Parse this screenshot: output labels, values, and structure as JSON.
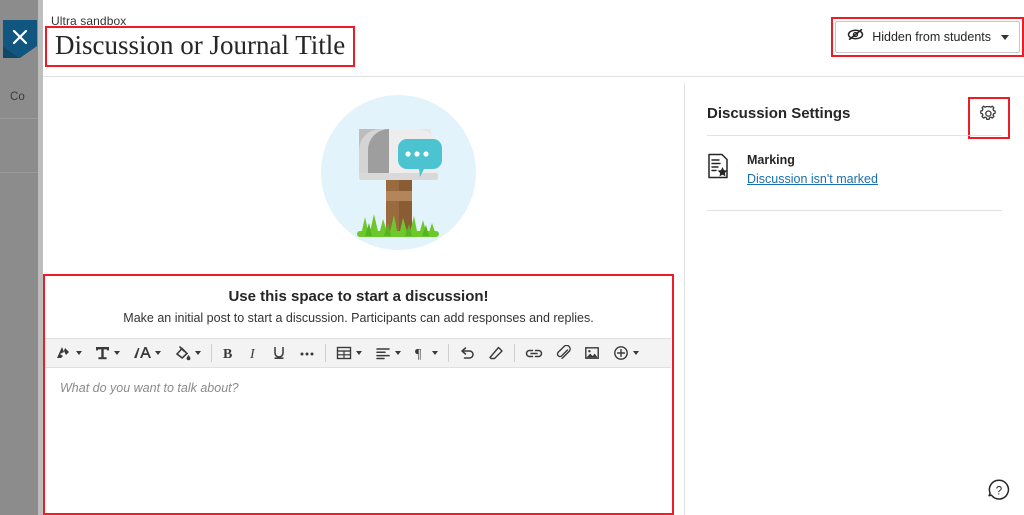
{
  "window": {
    "close_label": "Close",
    "accent_red": "#ee1c25",
    "ribbon_color": "#11567f",
    "link_color": "#1a6fb0"
  },
  "background_page": {
    "partial_label": "Co"
  },
  "header": {
    "breadcrumb": "Ultra sandbox",
    "title": "Discussion or Journal Title",
    "visibility": {
      "icon": "eye-slash-icon",
      "label": "Hidden from students",
      "caret": "chevron-down-icon"
    }
  },
  "main": {
    "illustration": "mailbox-with-chat-bubble-illustration",
    "editor": {
      "heading": "Use this space to start a discussion!",
      "subheading": "Make an initial post to start a discussion. Participants can add responses and replies.",
      "placeholder": "What do you want to talk about?",
      "toolbar": [
        {
          "name": "text-style-icon",
          "glyph": "pen-style",
          "caret": true
        },
        {
          "name": "text-format-icon",
          "glyph": "t-format",
          "caret": true
        },
        {
          "name": "font-size-icon",
          "glyph": "font-size",
          "caret": true
        },
        {
          "name": "highlight-color-icon",
          "glyph": "paint-fill",
          "caret": true
        },
        {
          "name": "bold-icon",
          "glyph": "bold",
          "caret": false
        },
        {
          "name": "italic-icon",
          "glyph": "italic",
          "caret": false
        },
        {
          "name": "underline-icon",
          "glyph": "underline",
          "caret": false
        },
        {
          "name": "more-options-icon",
          "glyph": "ellipsis",
          "caret": false
        },
        {
          "name": "insert-table-icon",
          "glyph": "table",
          "caret": true
        },
        {
          "name": "align-icon",
          "glyph": "align",
          "caret": true
        },
        {
          "name": "paragraph-icon",
          "glyph": "pilcrow",
          "caret": true
        },
        {
          "name": "undo-icon",
          "glyph": "undo",
          "caret": false
        },
        {
          "name": "clear-formatting-icon",
          "glyph": "eraser",
          "caret": false
        },
        {
          "name": "insert-link-icon",
          "glyph": "link",
          "caret": false
        },
        {
          "name": "attach-file-icon",
          "glyph": "paperclip",
          "caret": false
        },
        {
          "name": "insert-image-icon",
          "glyph": "image",
          "caret": false
        },
        {
          "name": "add-content-icon",
          "glyph": "plus-circle",
          "caret": true
        }
      ]
    }
  },
  "settings_panel": {
    "title": "Discussion Settings",
    "gear_icon": "gear-icon",
    "marking": {
      "icon": "marking-document-icon",
      "label": "Marking",
      "link": "Discussion isn't marked"
    }
  },
  "help": {
    "icon": "help-question-icon"
  }
}
